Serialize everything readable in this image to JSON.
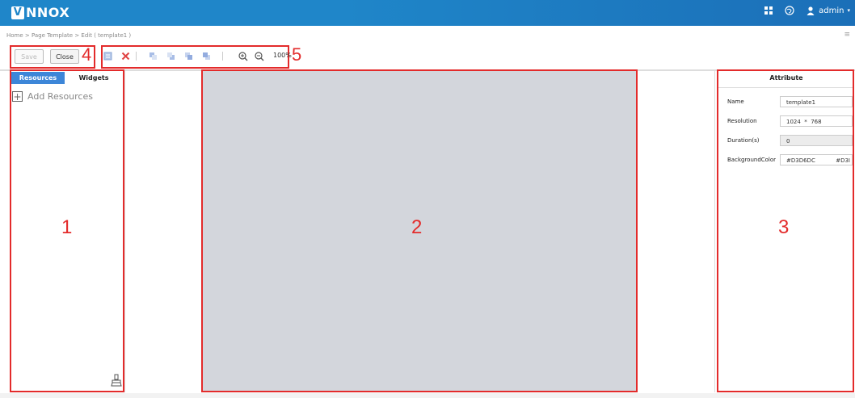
{
  "app": {
    "logo_text": "NNOX",
    "logo_letter": "V",
    "user": "admin"
  },
  "breadcrumb": "Home > Page Template > Edit ( template1 )",
  "toolbar": {
    "save_label": "Save",
    "close_label": "Close",
    "zoom_level": "100%",
    "icons": [
      "new-icon",
      "delete-icon",
      "bring-forward-icon",
      "send-backward-icon",
      "bring-to-front-icon",
      "send-to-back-icon",
      "zoom-in-icon",
      "zoom-out-icon"
    ]
  },
  "left_panel": {
    "tabs": [
      {
        "label": "Resources",
        "active": true
      },
      {
        "label": "Widgets",
        "active": false
      }
    ],
    "add_resources_label": "Add Resources"
  },
  "canvas": {
    "background_color": "#D3D6DC"
  },
  "attribute_panel": {
    "title": "Attribute",
    "fields": [
      {
        "label": "Name",
        "value": "template1"
      },
      {
        "label": "Resolution",
        "value": "1024  *  768"
      },
      {
        "label": "Duration(s)",
        "value": "0"
      },
      {
        "label": "BackgroundColor",
        "value": "#D3D6DC",
        "extra": "#D3I"
      }
    ]
  },
  "annotations": {
    "n1": "1",
    "n2": "2",
    "n3": "3",
    "n4": "4",
    "n5": "5"
  },
  "colors": {
    "topbar": "#1f86c9",
    "tab_active": "#3d86d8",
    "annotation_red": "#e32b2b"
  }
}
